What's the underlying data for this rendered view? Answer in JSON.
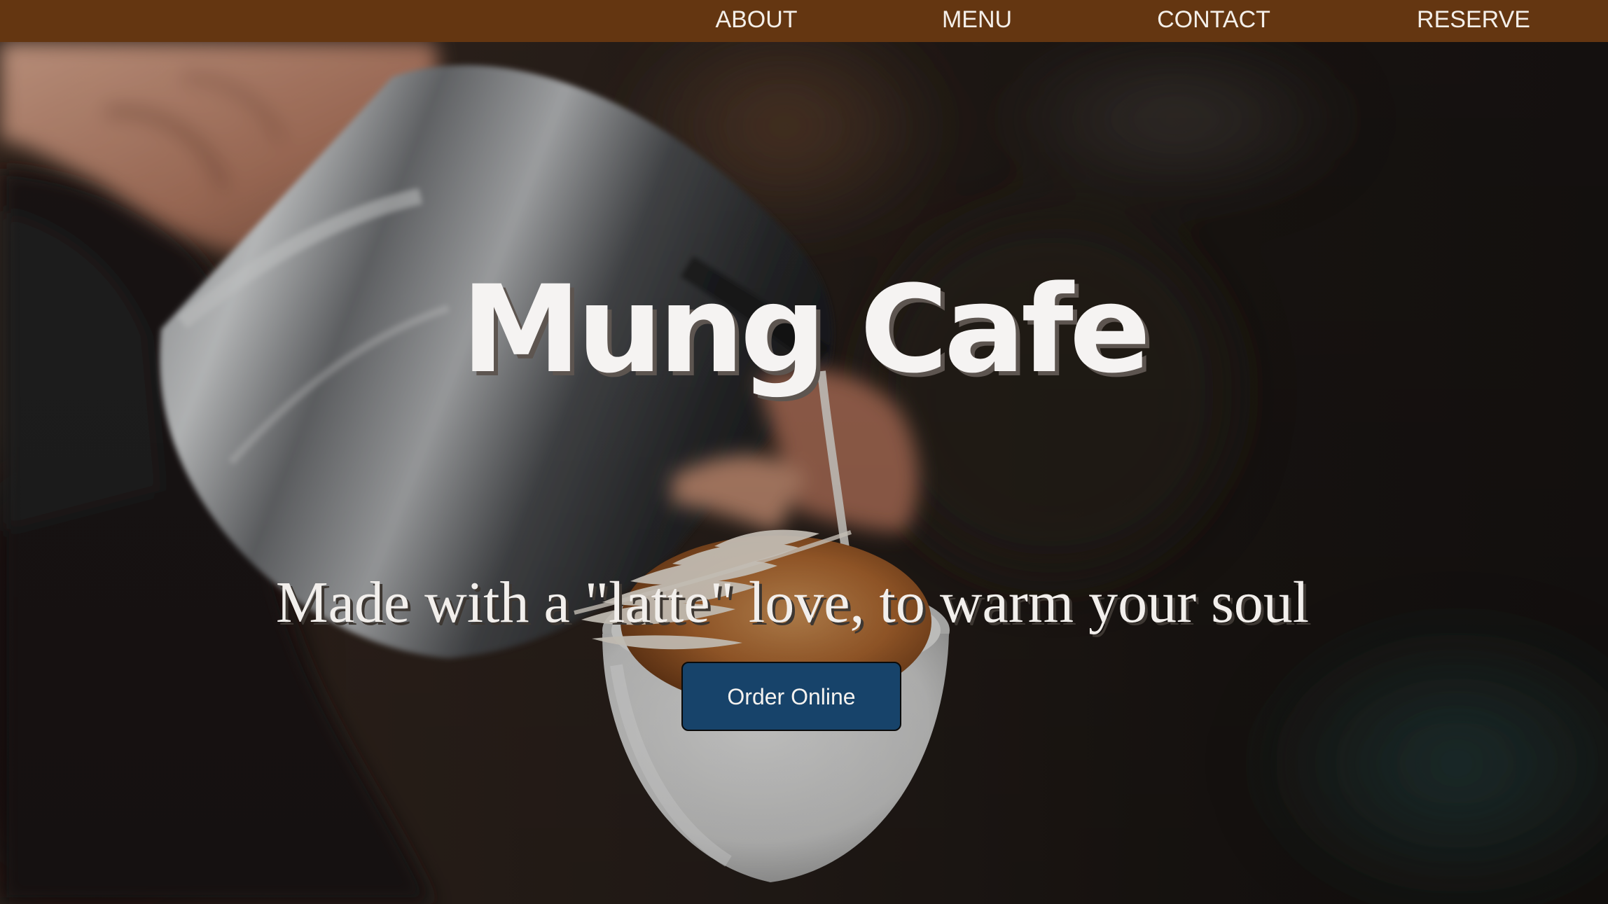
{
  "nav": {
    "items": [
      {
        "label": "ABOUT"
      },
      {
        "label": "MENU"
      },
      {
        "label": "CONTACT"
      },
      {
        "label": "RESERVE"
      }
    ]
  },
  "hero": {
    "title": "Mung Cafe",
    "tagline": "Made with a \"latte\" love, to warm your soul",
    "cta_label": "Order Online",
    "background_image": "barista-pouring-latte-art-photo"
  },
  "colors": {
    "navbar_bg": "#643611",
    "nav_text": "#f4efe9",
    "button_bg": "#17436a",
    "title_text": "#f5f3f2"
  }
}
